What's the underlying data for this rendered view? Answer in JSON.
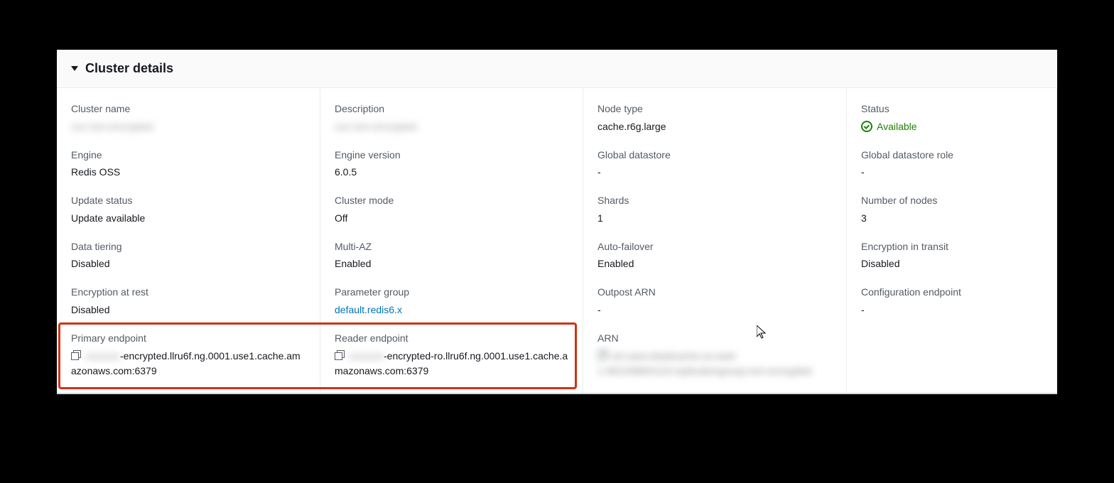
{
  "panel": {
    "title": "Cluster details"
  },
  "col1": {
    "cluster_name_label": "Cluster name",
    "cluster_name_value": "xxx-non-encrypted",
    "engine_label": "Engine",
    "engine_value": "Redis OSS",
    "update_status_label": "Update status",
    "update_status_value": "Update available",
    "data_tiering_label": "Data tiering",
    "data_tiering_value": "Disabled",
    "encryption_at_rest_label": "Encryption at rest",
    "encryption_at_rest_value": "Disabled",
    "primary_endpoint_label": "Primary endpoint",
    "primary_endpoint_prefix": "xxxxxxx",
    "primary_endpoint_suffix": "-encrypted.llru6f.ng.0001.use1.cache.amazonaws.com:6379"
  },
  "col2": {
    "description_label": "Description",
    "description_value": "xxx-non-encrypted",
    "engine_version_label": "Engine version",
    "engine_version_value": "6.0.5",
    "cluster_mode_label": "Cluster mode",
    "cluster_mode_value": "Off",
    "multi_az_label": "Multi-AZ",
    "multi_az_value": "Enabled",
    "parameter_group_label": "Parameter group",
    "parameter_group_value": "default.redis6.x",
    "reader_endpoint_label": "Reader endpoint",
    "reader_endpoint_prefix": "xxxxxxx",
    "reader_endpoint_suffix": "-encrypted-ro.llru6f.ng.0001.use1.cache.amazonaws.com:6379"
  },
  "col3": {
    "node_type_label": "Node type",
    "node_type_value": "cache.r6g.large",
    "global_datastore_label": "Global datastore",
    "global_datastore_value": "-",
    "shards_label": "Shards",
    "shards_value": "1",
    "auto_failover_label": "Auto-failover",
    "auto_failover_value": "Enabled",
    "outpost_arn_label": "Outpost ARN",
    "outpost_arn_value": "-",
    "arn_label": "ARN",
    "arn_value": "arn:aws:elasticache:us-east-1:481036804115:replicationgroup:non-encrypted"
  },
  "col4": {
    "status_label": "Status",
    "status_value": "Available",
    "global_datastore_role_label": "Global datastore role",
    "global_datastore_role_value": "-",
    "number_of_nodes_label": "Number of nodes",
    "number_of_nodes_value": "3",
    "encryption_in_transit_label": "Encryption in transit",
    "encryption_in_transit_value": "Disabled",
    "configuration_endpoint_label": "Configuration endpoint",
    "configuration_endpoint_value": "-"
  }
}
